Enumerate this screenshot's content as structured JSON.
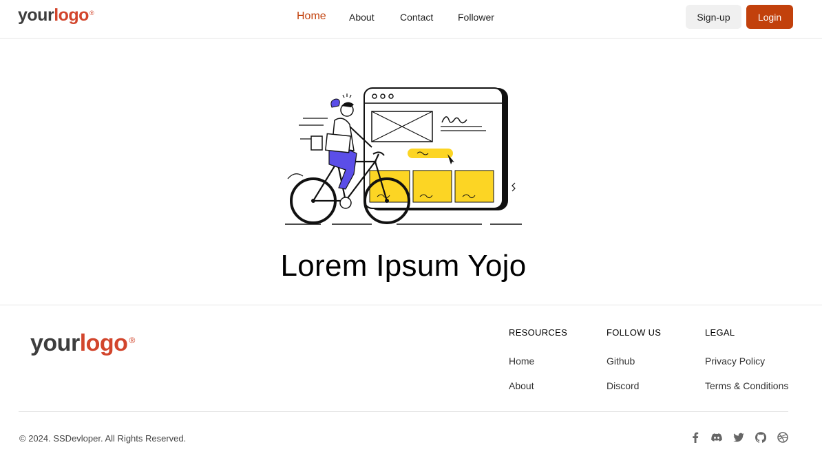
{
  "header": {
    "logo": {
      "your": "your",
      "logo": "logo",
      "reg": "®"
    },
    "nav": [
      {
        "label": "Home",
        "active": true
      },
      {
        "label": "About"
      },
      {
        "label": "Contact"
      },
      {
        "label": "Follower"
      }
    ],
    "signup_label": "Sign-up",
    "login_label": "Login"
  },
  "hero": {
    "title": "Lorem Ipsum Yojo"
  },
  "footer": {
    "logo": {
      "your": "your",
      "logo": "logo",
      "reg": "®"
    },
    "columns": [
      {
        "heading": "RESOURCES",
        "links": [
          "Home",
          "About"
        ]
      },
      {
        "heading": "FOLLOW US",
        "links": [
          "Github",
          "Discord"
        ]
      },
      {
        "heading": "LEGAL",
        "links": [
          "Privacy Policy",
          "Terms & Conditions"
        ]
      }
    ],
    "copyright": "© 2024. SSDevloper. All Rights Reserved.",
    "social_icons": [
      "facebook-icon",
      "discord-icon",
      "twitter-icon",
      "github-icon",
      "dribbble-icon"
    ]
  },
  "colors": {
    "accent": "#c2410c",
    "logo_red": "#d2452c",
    "illustration_yellow": "#fcd524",
    "illustration_purple": "#5b4ee8"
  }
}
